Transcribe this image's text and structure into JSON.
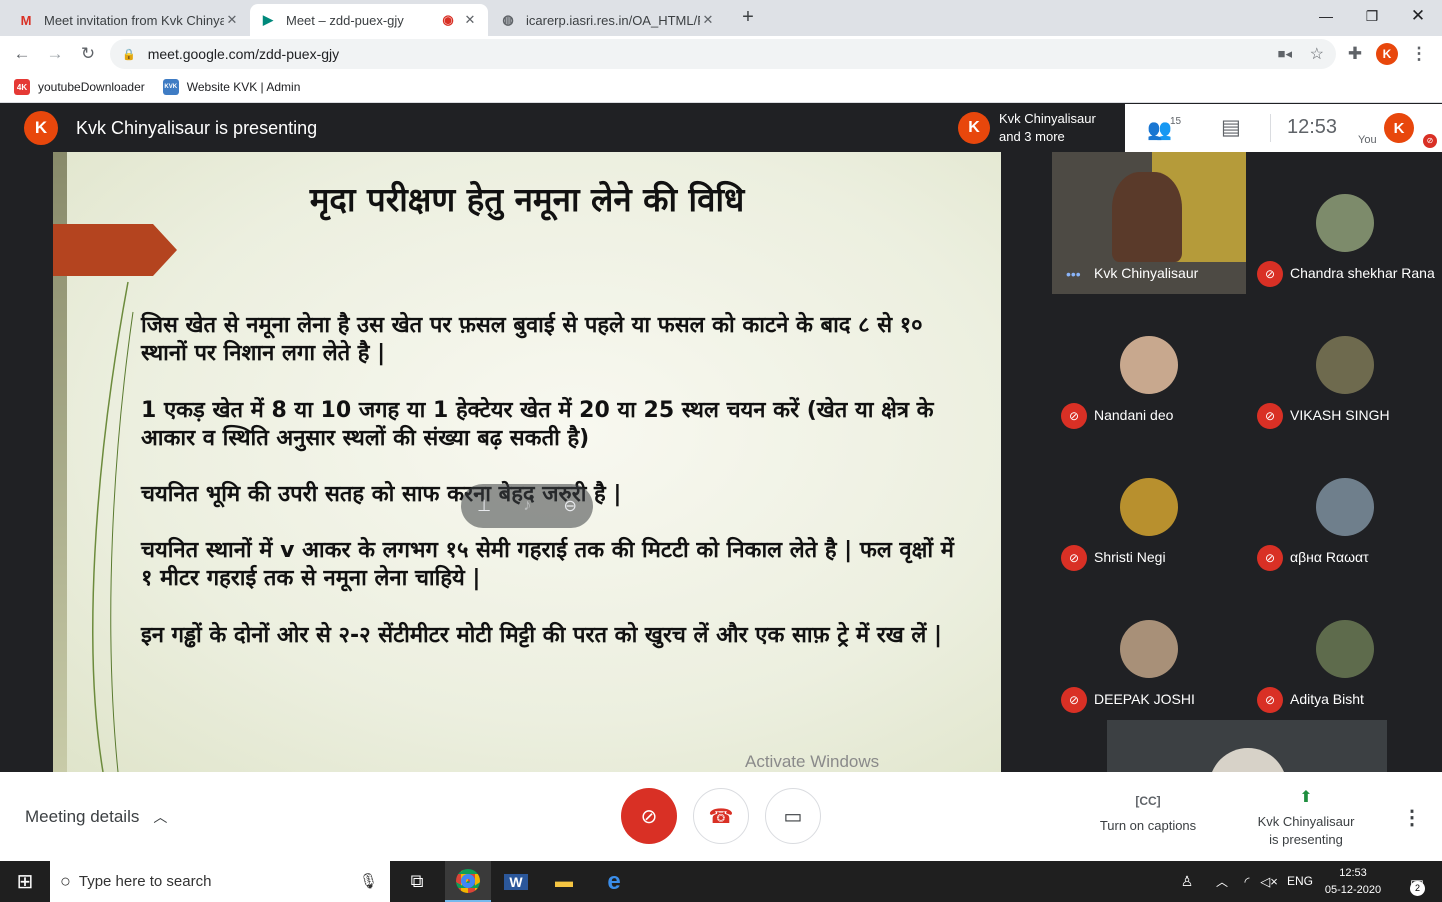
{
  "browser": {
    "tabs": [
      {
        "title": "Meet invitation from Kvk Chinyali",
        "icon": "gmail-icon"
      },
      {
        "title": "Meet – zdd-puex-gjy",
        "icon": "meet-icon"
      },
      {
        "title": "icarerp.iasri.res.in/OA_HTML/RF.js",
        "icon": "globe-icon"
      }
    ],
    "new_tab": "+",
    "url": "meet.google.com/zdd-puex-gjy",
    "profile_initial": "K",
    "bookmarks": [
      {
        "label": "youtubeDownloader",
        "icon": "4K"
      },
      {
        "label": "Website KVK | Admin",
        "icon": "KVK"
      }
    ]
  },
  "meet": {
    "presenter_initial": "K",
    "presenting_text": "Kvk Chinyalisaur is presenting",
    "top_avatar_initial": "K",
    "top_names_line1": "Kvk Chinyalisaur",
    "top_names_line2": "and 3 more",
    "people_count": "15",
    "time": "12:53",
    "you_label": "You",
    "you_initial": "K",
    "slide": {
      "title": "मृदा परीक्षण हेतु नमूना लेने की विधि",
      "paragraphs": [
        "जिस खेत से नमूना लेना है उस खेत पर फ़सल बुवाई से पहले या फसल को काटने के बाद ८ से १० स्थानों पर निशान लगा लेते है |",
        "1 एकड़ खेत में 8 या 10 जगह या 1 हेक्टेयर खेत में 20 या 25 स्थल चयन करें (खेत या क्षेत्र के आकार व स्थिति अनुसार स्थलों की संख्या बढ़ सकती है)",
        "चयनित भूमि की उपरी सतह को साफ करना बेहद जरुरी है |",
        "चयनित स्थानों में v आकर के लगभग १५ सेमी गहराई तक की मिटटी को निकाल लेते है | फल वृक्षों में १ मीटर गहराई तक से नमूना लेना चाहिये |",
        "इन गड्ढों के दोनों ओर से २-२ सेंटीमीटर मोटी मिट्टी की परत को खुरच लें और एक साफ़ ट्रे में रख लें |"
      ],
      "watermark": "Activate Windows"
    },
    "participants": [
      {
        "name": "Kvk Chinyalisaur",
        "muted": false
      },
      {
        "name": "Chandra shekhar Rana",
        "muted": true
      },
      {
        "name": "Nandani deo",
        "muted": true
      },
      {
        "name": "VIKASH SINGH",
        "muted": true
      },
      {
        "name": "Shristi Negi",
        "muted": true
      },
      {
        "name": "αβнα Rαωατ",
        "muted": true
      },
      {
        "name": "DEEPAK JOSHI",
        "muted": true
      },
      {
        "name": "Aditya Bisht",
        "muted": true
      }
    ],
    "meeting_details": "Meeting details",
    "captions_label": "Turn on captions",
    "presenting_line1": "Kvk Chinyalisaur",
    "presenting_line2": "is presenting"
  },
  "taskbar": {
    "search_placeholder": "Type here to search",
    "lang": "ENG",
    "clock_time": "12:53",
    "clock_date": "05-12-2020",
    "notifications": "2"
  },
  "colors": {
    "accent": "#e8470c",
    "danger": "#d93025",
    "meet_dark": "#202124"
  }
}
